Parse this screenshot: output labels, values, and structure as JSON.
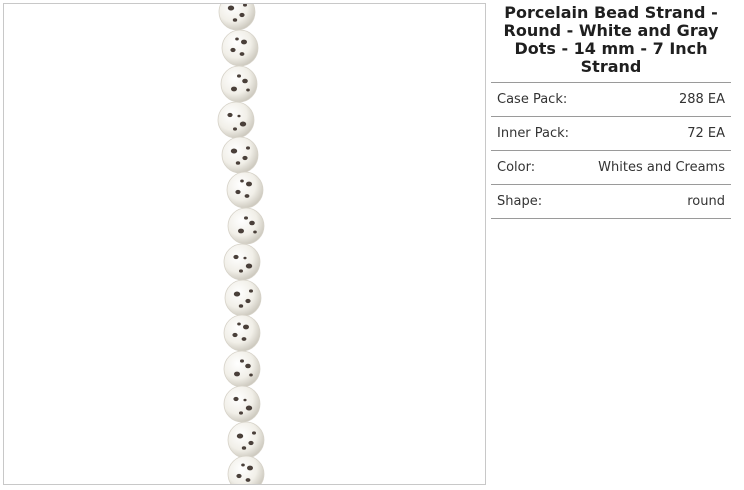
{
  "product": {
    "title": "Porcelain Bead Strand - Round - White and Gray Dots - 14 mm - 7 Inch Strand",
    "image_alt": "Porcelain Bead Strand - Round - White and Gray Dots",
    "specs": [
      {
        "label": "Case Pack:",
        "value": "288 EA"
      },
      {
        "label": "Inner Pack:",
        "value": "72 EA"
      },
      {
        "label": "Color:",
        "value": "Whites and Creams"
      },
      {
        "label": "Shape:",
        "value": "round"
      }
    ]
  },
  "colors": {
    "bead_body": "#f1efe8",
    "bead_shadow": "#c9c5ba",
    "dot": "#4a403a",
    "border": "#9a9a9a"
  }
}
